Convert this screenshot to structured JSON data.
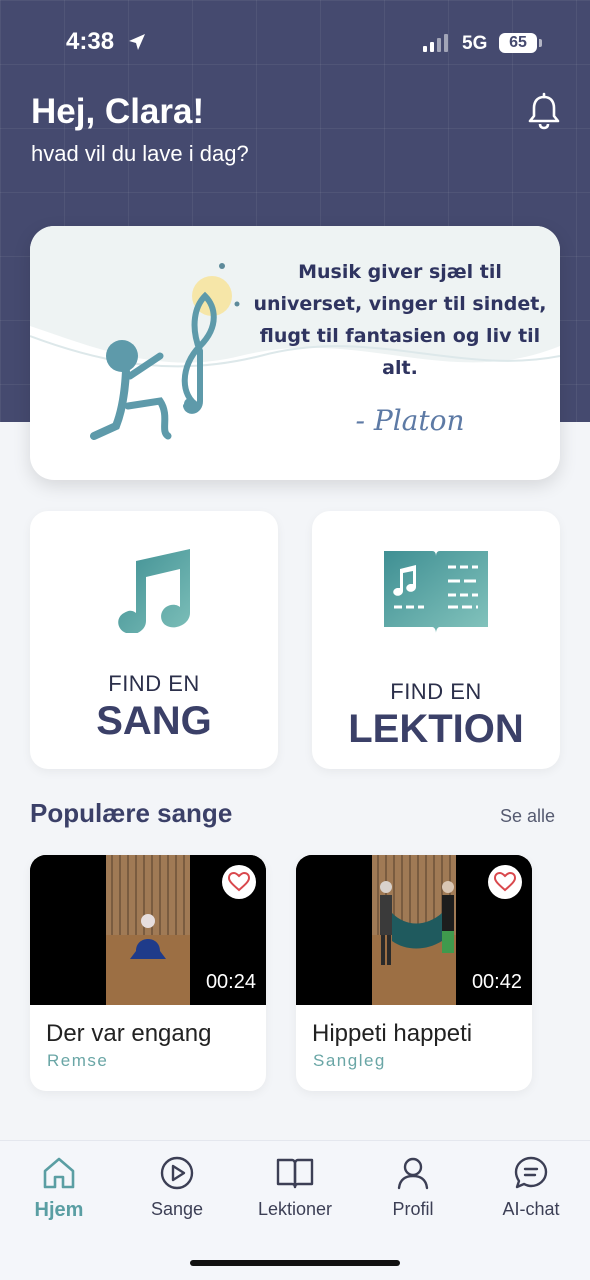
{
  "status_bar": {
    "time": "4:38",
    "network": "5G",
    "battery": "65"
  },
  "header": {
    "greeting": "Hej, Clara!",
    "subtitle": "hvad vil du lave i dag?"
  },
  "quote": {
    "text": "Musik giver sjæl til universet, vinger til sindet, flugt til fantasien og liv til alt.",
    "author": "- Platon"
  },
  "tiles": [
    {
      "small": "FIND EN",
      "big": "SANG",
      "icon": "music-note-icon"
    },
    {
      "small": "FIND EN",
      "big": "LEKTION",
      "icon": "open-book-icon"
    }
  ],
  "popular": {
    "title": "Populære sange",
    "see_all": "Se alle",
    "songs": [
      {
        "title": "Der var engang",
        "category": "Remse",
        "duration": "00:24"
      },
      {
        "title": "Hippeti happeti",
        "category": "Sangleg",
        "duration": "00:42"
      }
    ]
  },
  "tabbar": {
    "items": [
      {
        "label": "Hjem",
        "icon": "home-icon",
        "active": true
      },
      {
        "label": "Sange",
        "icon": "play-circle-icon",
        "active": false
      },
      {
        "label": "Lektioner",
        "icon": "book-icon",
        "active": false
      },
      {
        "label": "Profil",
        "icon": "person-icon",
        "active": false
      },
      {
        "label": "AI-chat",
        "icon": "chat-bubble-icon",
        "active": false
      }
    ]
  },
  "colors": {
    "header_bg": "#454a6f",
    "accent_teal": "#5a9ea3",
    "title_navy": "#3b4068"
  }
}
